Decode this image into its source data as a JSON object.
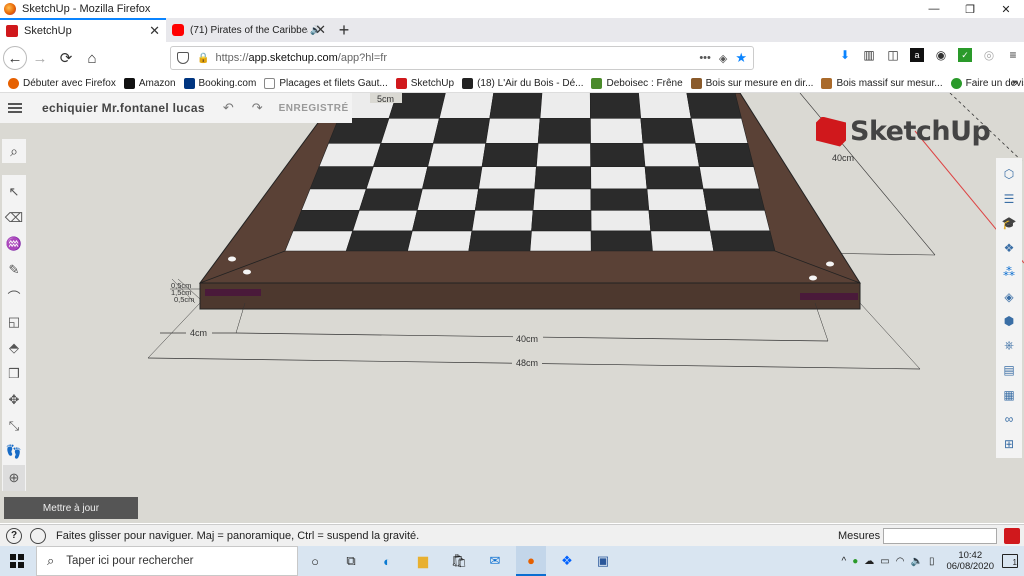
{
  "window": {
    "title": "SketchUp - Mozilla Firefox",
    "controls": [
      "—",
      "❐",
      "✕"
    ]
  },
  "tabs": [
    {
      "label": "SketchUp",
      "icon": "sketchup-icon",
      "active": true
    },
    {
      "label": "(71) Pirates of the Caribbean",
      "icon": "youtube-icon",
      "active": false,
      "audio": "🔊"
    }
  ],
  "nav": {
    "url_prefix": "https://",
    "url_host": "app.sketchup.com",
    "url_path": "/app?hl=fr",
    "page_actions": "•••",
    "star": "★"
  },
  "bookmarks": [
    {
      "label": "Débuter avec Firefox",
      "color": "#e66000"
    },
    {
      "label": "Amazon",
      "color": "#111111"
    },
    {
      "label": "Booking.com",
      "color": "#003580"
    },
    {
      "label": "Placages et filets Gaut...",
      "color": "#888888"
    },
    {
      "label": "SketchUp",
      "color": "#d0181c"
    },
    {
      "label": "(18) L'Air du Bois - Dé...",
      "color": "#222222"
    },
    {
      "label": "Deboisec : Frêne",
      "color": "#4a8a2a"
    },
    {
      "label": "Bois sur mesure en dir...",
      "color": "#8a5a2a"
    },
    {
      "label": "Bois massif sur mesur...",
      "color": "#aa6a2a"
    },
    {
      "label": "Faire un devis en ligne...",
      "color": "#2a9a2a"
    }
  ],
  "bookmarks_more": "»",
  "app": {
    "doc_title": "echiquier Mr.fontanel lucas",
    "undo": "↶",
    "redo": "↷",
    "saved": "ENREGISTRÉ",
    "logo_text": "SketchUp",
    "update_button": "Mettre à jour"
  },
  "dimensions": {
    "border_5": "5cm",
    "side_40": "40cm",
    "border_4": "4cm",
    "inner_40": "40cm",
    "outer_48": "48cm",
    "small_a": "0,5cm",
    "small_b": "1,5cm",
    "small_c": "0,5cm"
  },
  "status": {
    "help": "?",
    "hint": "Faites glisser pour naviguer. Maj = panoramique, Ctrl = suspend la gravité.",
    "measure_label": "Mesures",
    "measure_value": ""
  },
  "taskbar": {
    "search_placeholder": "Taper ici pour rechercher",
    "time": "10:42",
    "date": "06/08/2020",
    "notification_count": "1"
  },
  "colors": {
    "frame_wood": "#5a4136",
    "dark_square": "#2b2b2b",
    "light_square": "#ececec",
    "slot": "#4a1a3a",
    "accent_blue": "#0a84ff",
    "sketchup_red": "#d0181c"
  }
}
